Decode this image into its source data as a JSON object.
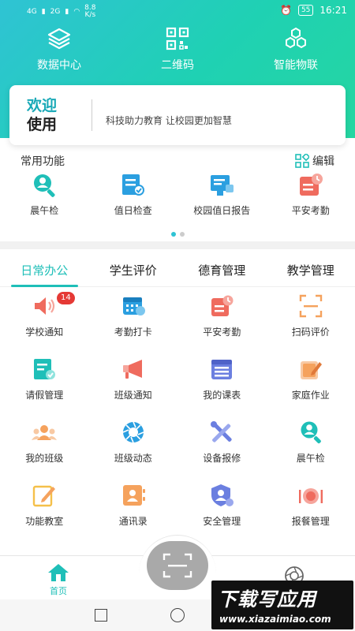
{
  "status_bar": {
    "signal_left": "4G",
    "signal_mid": "2G",
    "speed": "8.8",
    "speed_unit": "K/s",
    "battery": "55",
    "time": "16:21"
  },
  "top_nav": [
    {
      "label": "数据中心",
      "icon": "layers-icon"
    },
    {
      "label": "二维码",
      "icon": "qr-code-icon"
    },
    {
      "label": "智能物联",
      "icon": "iot-hexagon-icon"
    }
  ],
  "welcome": {
    "line1": "欢迎",
    "line2": "使用",
    "slogan": "科技助力教育  让校园更加智慧"
  },
  "common": {
    "title": "常用功能",
    "edit_label": "编辑",
    "items": [
      {
        "label": "晨午检",
        "icon": "magnifier-person-icon",
        "color": "#1fbfb8"
      },
      {
        "label": "值日检查",
        "icon": "checklist-icon",
        "color": "#2b9fe0"
      },
      {
        "label": "校园值日报告",
        "icon": "report-board-icon",
        "color": "#2b9fe0"
      },
      {
        "label": "平安考勤",
        "icon": "clock-card-icon",
        "color": "#ef6b5e"
      }
    ]
  },
  "tabs": [
    {
      "label": "日常办公",
      "active": true
    },
    {
      "label": "学生评价",
      "active": false
    },
    {
      "label": "德育管理",
      "active": false
    },
    {
      "label": "教学管理",
      "active": false
    }
  ],
  "grid": [
    [
      {
        "label": "学校通知",
        "icon": "speaker-icon",
        "color": "#ef6b5e",
        "badge": "14"
      },
      {
        "label": "考勤打卡",
        "icon": "calendar-icon",
        "color": "#2b9fe0"
      },
      {
        "label": "平安考勤",
        "icon": "clock-card-icon",
        "color": "#ef6b5e"
      },
      {
        "label": "扫码评价",
        "icon": "scan-frame-icon",
        "color": "#f5a25d"
      }
    ],
    [
      {
        "label": "请假管理",
        "icon": "leave-form-icon",
        "color": "#1fbfb8"
      },
      {
        "label": "班级通知",
        "icon": "megaphone-icon",
        "color": "#ef6b5e"
      },
      {
        "label": "我的课表",
        "icon": "schedule-icon",
        "color": "#6b7fe0"
      },
      {
        "label": "家庭作业",
        "icon": "homework-icon",
        "color": "#f5a25d"
      }
    ],
    [
      {
        "label": "我的班级",
        "icon": "group-icon",
        "color": "#f5a25d"
      },
      {
        "label": "班级动态",
        "icon": "aperture-icon",
        "color": "#2b9fe0"
      },
      {
        "label": "设备报修",
        "icon": "tools-icon",
        "color": "#6b7fe0"
      },
      {
        "label": "晨午检",
        "icon": "magnifier-person-icon",
        "color": "#1fbfb8"
      }
    ],
    [
      {
        "label": "功能教室",
        "icon": "notebook-pen-icon",
        "color": "#f5c04a"
      },
      {
        "label": "通讯录",
        "icon": "contacts-icon",
        "color": "#f5a25d"
      },
      {
        "label": "安全管理",
        "icon": "shield-user-icon",
        "color": "#6b7fe0"
      },
      {
        "label": "报餐管理",
        "icon": "meal-icon",
        "color": "#ef6b5e"
      }
    ]
  ],
  "bottom_bar": {
    "home_label": "首页"
  },
  "watermark": {
    "title": "下载写应用",
    "url": "www.xiazaimiao.com"
  },
  "colors": {
    "accent": "#1fbfb8",
    "header_start": "#2fc3d4",
    "header_end": "#25d6a1"
  }
}
